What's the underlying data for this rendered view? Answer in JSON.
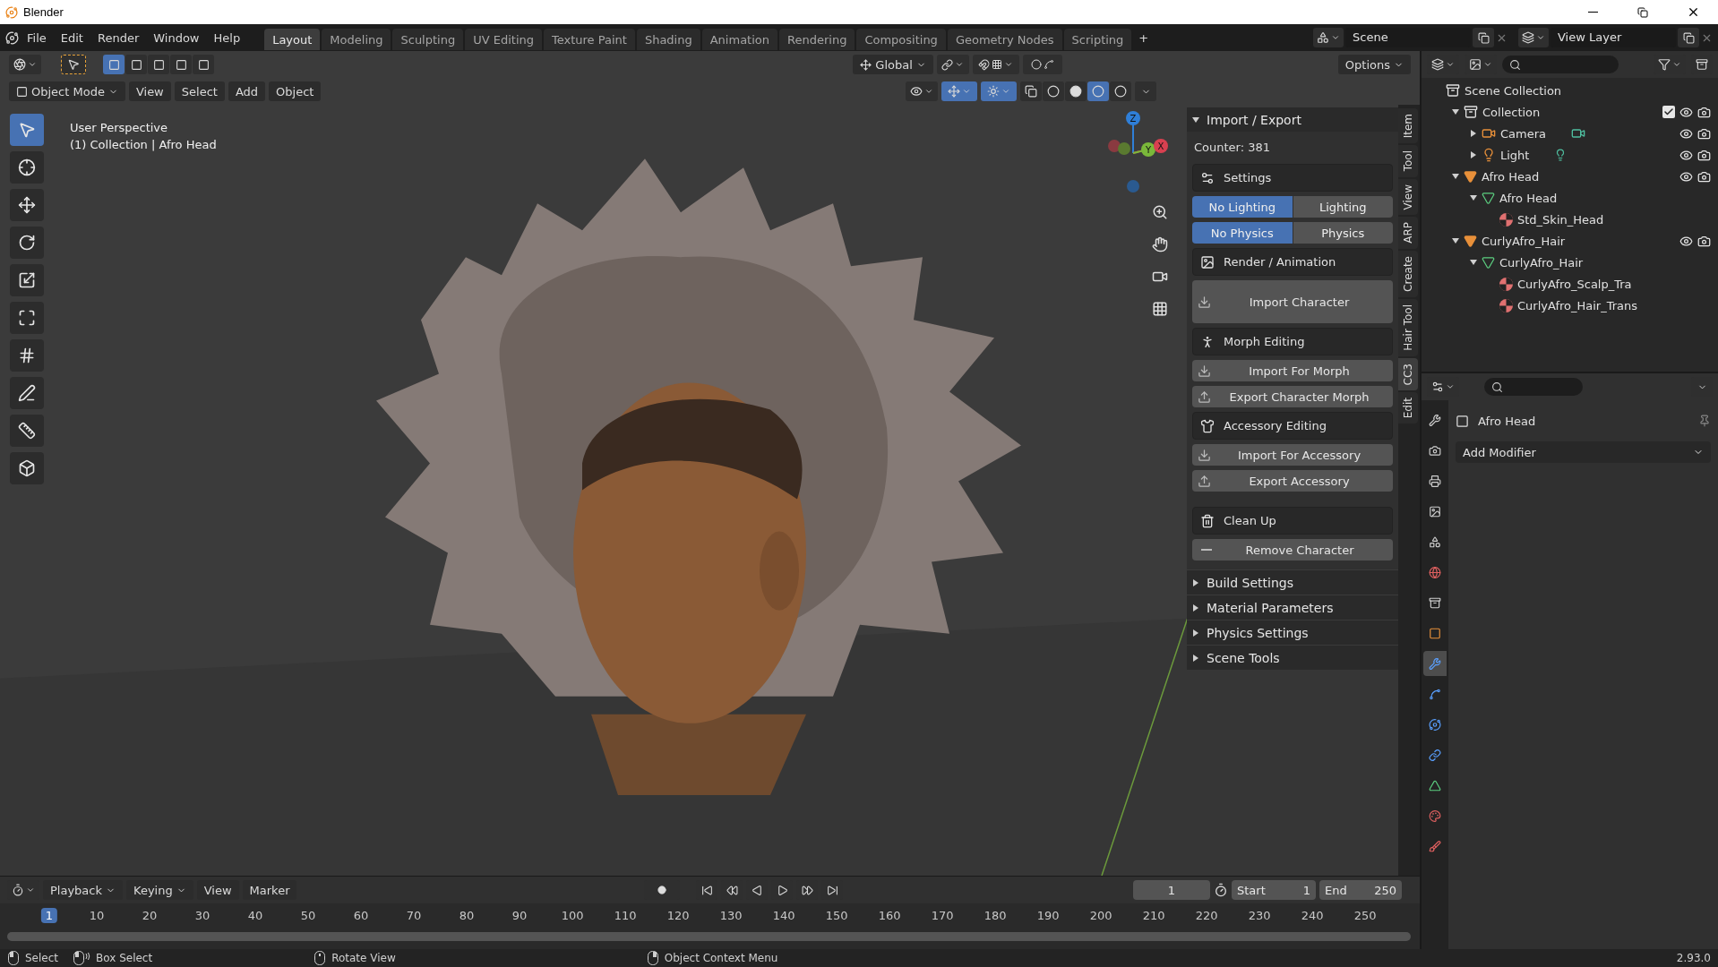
{
  "window": {
    "title": "Blender"
  },
  "app_menu": [
    "File",
    "Edit",
    "Render",
    "Window",
    "Help"
  ],
  "workspaces": [
    {
      "label": "Layout",
      "selected": true
    },
    {
      "label": "Modeling",
      "selected": false
    },
    {
      "label": "Sculpting",
      "selected": false
    },
    {
      "label": "UV Editing",
      "selected": false
    },
    {
      "label": "Texture Paint",
      "selected": false
    },
    {
      "label": "Shading",
      "selected": false
    },
    {
      "label": "Animation",
      "selected": false
    },
    {
      "label": "Rendering",
      "selected": false
    },
    {
      "label": "Compositing",
      "selected": false
    },
    {
      "label": "Geometry Nodes",
      "selected": false
    },
    {
      "label": "Scripting",
      "selected": false
    }
  ],
  "add_workspace": "+",
  "scene": "Scene",
  "view_layer": "View Layer",
  "tool_header": {
    "selection_modes": [
      {
        "selected": true
      },
      {
        "selected": false
      },
      {
        "selected": false
      },
      {
        "selected": false
      },
      {
        "selected": false
      }
    ],
    "orientation": "Global",
    "options": "Options"
  },
  "viewport_header": {
    "mode": "Object Mode",
    "menus": [
      "View",
      "Select",
      "Add",
      "Object"
    ],
    "overlay_buttons": [
      {
        "kind": "gizmo",
        "on": true
      },
      {
        "kind": "overlay",
        "on": true
      },
      {
        "kind": "xray",
        "on": false
      }
    ],
    "shading_modes": [
      {
        "selected": false
      },
      {
        "selected": false
      },
      {
        "selected": true
      },
      {
        "selected": false
      }
    ]
  },
  "viewport": {
    "info": [
      "User Perspective",
      "(1) Collection | Afro Head"
    ],
    "axes": [
      "Z",
      "Y",
      "X"
    ],
    "tools": [
      {
        "kind": "select",
        "selected": true
      },
      {
        "kind": "cursor",
        "selected": false
      },
      {
        "kind": "move",
        "selected": false
      },
      {
        "kind": "rotate",
        "selected": false
      },
      {
        "kind": "scale",
        "selected": false
      },
      {
        "kind": "transform",
        "selected": false
      },
      {
        "kind": "annotate",
        "selected": false
      },
      {
        "kind": "draw",
        "selected": false
      },
      {
        "kind": "measure",
        "selected": false
      },
      {
        "kind": "add_cube",
        "selected": false
      }
    ]
  },
  "sidebar": {
    "panel_title": "Import / Export",
    "counter": "Counter: 381",
    "items": [
      {
        "kind": "settings",
        "label": "Settings"
      },
      {
        "kind": "toggle",
        "options": [
          {
            "label": "No Lighting",
            "selected": true
          },
          {
            "label": "Lighting",
            "selected": false
          }
        ]
      },
      {
        "kind": "toggle",
        "options": [
          {
            "label": "No Physics",
            "selected": true
          },
          {
            "label": "Physics",
            "selected": false
          }
        ]
      },
      {
        "kind": "render",
        "label": "Render / Animation"
      },
      {
        "kind": "import_large",
        "label": "Import Character"
      },
      {
        "kind": "morph",
        "label": "Morph Editing"
      },
      {
        "kind": "import",
        "label": "Import For Morph"
      },
      {
        "kind": "export",
        "label": "Export Character Morph"
      },
      {
        "kind": "accessory",
        "label": "Accessory Editing"
      },
      {
        "kind": "import",
        "label": "Import For Accessory"
      },
      {
        "kind": "export",
        "label": "Export Accessory"
      },
      {
        "kind": "cleanup",
        "label": "Clean Up"
      },
      {
        "kind": "remove",
        "label": "Remove Character"
      }
    ],
    "collapsed_panels": [
      "Build Settings",
      "Material Parameters",
      "Physics Settings",
      "Scene Tools"
    ],
    "tabs": [
      {
        "label": "Item",
        "selected": false
      },
      {
        "label": "Tool",
        "selected": false
      },
      {
        "label": "View",
        "selected": false
      },
      {
        "label": "ARP",
        "selected": false
      },
      {
        "label": "Create",
        "selected": false
      },
      {
        "label": "Hair Tool",
        "selected": false
      },
      {
        "label": "CC3",
        "selected": true
      },
      {
        "label": "Edit",
        "selected": false
      }
    ]
  },
  "outliner": {
    "root": "Scene Collection",
    "items": [
      {
        "kind": "collection",
        "name": "Collection",
        "expanded": true,
        "checked": true,
        "visible": true,
        "renderable": true,
        "children": [
          {
            "kind": "camera",
            "name": "Camera",
            "expanded": false,
            "visible": true,
            "renderable": true
          },
          {
            "kind": "light",
            "name": "Light",
            "expanded": false,
            "visible": true,
            "renderable": true
          }
        ]
      },
      {
        "kind": "object",
        "name": "Afro Head",
        "expanded": true,
        "visible": true,
        "renderable": true,
        "children": [
          {
            "kind": "mesh",
            "name": "Afro Head",
            "expanded": true,
            "children": [
              {
                "kind": "material",
                "name": "Std_Skin_Head"
              }
            ]
          }
        ]
      },
      {
        "kind": "object",
        "name": "CurlyAfro_Hair",
        "expanded": true,
        "visible": true,
        "renderable": true,
        "children": [
          {
            "kind": "mesh",
            "name": "CurlyAfro_Hair",
            "expanded": true,
            "children": [
              {
                "kind": "material",
                "name": "CurlyAfro_Scalp_Tra"
              },
              {
                "kind": "material",
                "name": "CurlyAfro_Hair_Trans"
              }
            ]
          }
        ]
      }
    ]
  },
  "properties": {
    "tabs": [
      {
        "kind": "tool",
        "selected": false
      },
      {
        "kind": "render",
        "selected": false
      },
      {
        "kind": "output",
        "selected": false
      },
      {
        "kind": "view_layer",
        "selected": false
      },
      {
        "kind": "scene",
        "selected": false
      },
      {
        "kind": "world",
        "selected": false
      },
      {
        "kind": "collection",
        "selected": false
      },
      {
        "kind": "object",
        "selected": false
      },
      {
        "kind": "modifier",
        "selected": true
      },
      {
        "kind": "particles",
        "selected": false
      },
      {
        "kind": "physics",
        "selected": false
      },
      {
        "kind": "constraints",
        "selected": false
      },
      {
        "kind": "data",
        "selected": false
      },
      {
        "kind": "material",
        "selected": false
      },
      {
        "kind": "texture",
        "selected": false
      }
    ],
    "object": "Afro Head",
    "add_modifier": "Add Modifier"
  },
  "timeline": {
    "menus": [
      "Playback",
      "Keying",
      "View",
      "Marker"
    ],
    "current_frame": "1",
    "start_label": "Start",
    "start": "1",
    "end_label": "End",
    "end": "250",
    "ticks": [
      "1",
      "10",
      "20",
      "30",
      "40",
      "50",
      "60",
      "70",
      "80",
      "90",
      "100",
      "110",
      "120",
      "130",
      "140",
      "150",
      "160",
      "170",
      "180",
      "190",
      "200",
      "210",
      "220",
      "230",
      "240",
      "250"
    ]
  },
  "status_bar": {
    "hints": [
      {
        "kind": "left",
        "label": "Select"
      },
      {
        "kind": "left_drag",
        "label": "Box Select"
      },
      {
        "kind": "middle",
        "label": "Rotate View"
      },
      {
        "kind": "right",
        "label": "Object Context Menu"
      }
    ],
    "version": "2.93.0"
  }
}
